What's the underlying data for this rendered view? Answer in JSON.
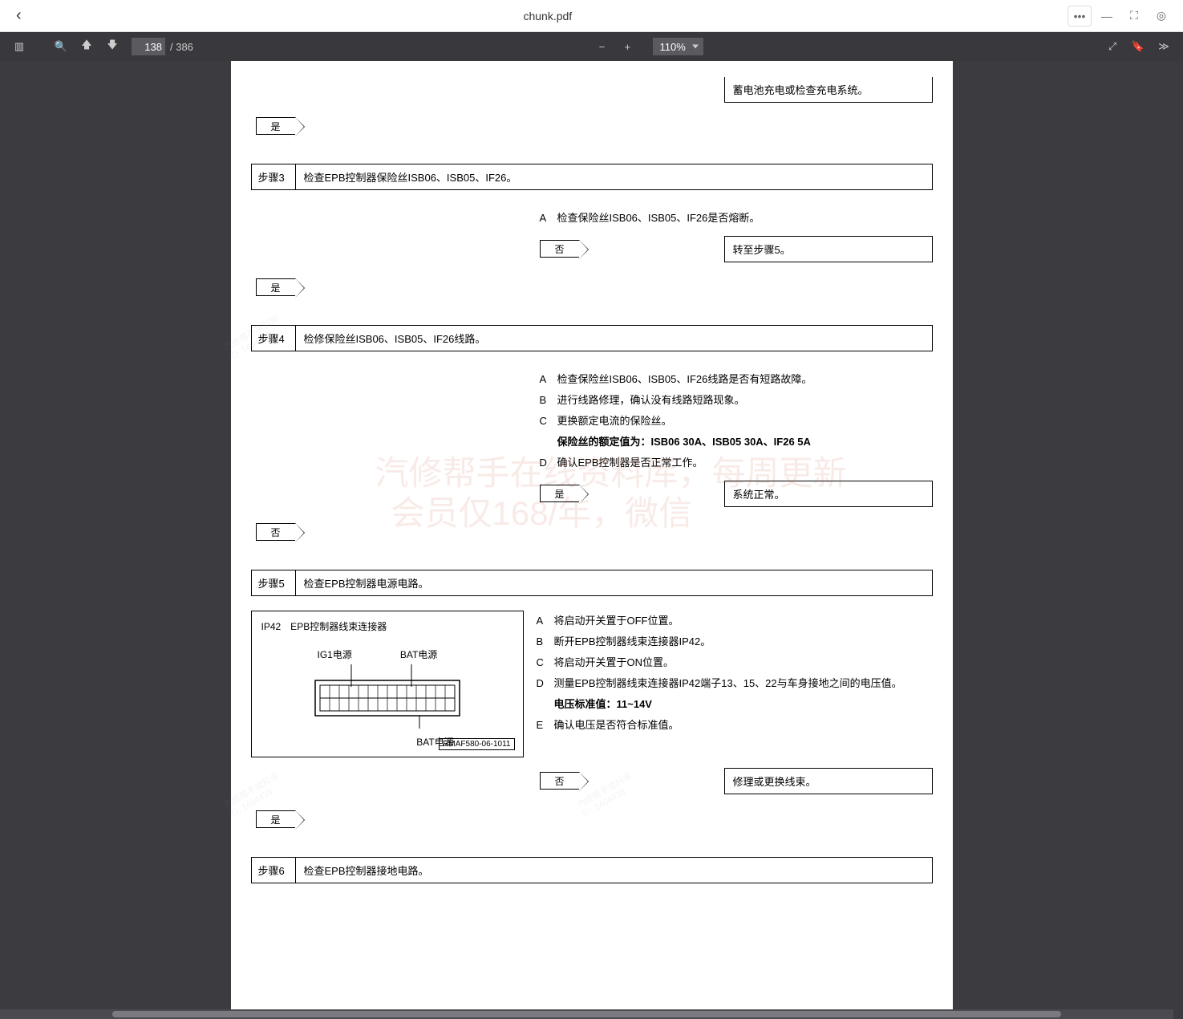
{
  "window": {
    "title": "chunk.pdf"
  },
  "toolbar": {
    "current_page": "138",
    "total_pages": "/ 386",
    "zoom": "110%"
  },
  "doc": {
    "top_action": "蓄电池充电或检查充电系统。",
    "yes": "是",
    "no": "否",
    "step3": {
      "label": "步骤3",
      "content": "检查EPB控制器保险丝ISB06、ISB05、IF26。",
      "A": "检查保险丝ISB06、ISB05、IF26是否熔断。",
      "no_action": "转至步骤5。"
    },
    "step4": {
      "label": "步骤4",
      "content": "检修保险丝ISB06、ISB05、IF26线路。",
      "A": "检查保险丝ISB06、ISB05、IF26线路是否有短路故障。",
      "B": "进行线路修理，确认没有线路短路现象。",
      "C": "更换额定电流的保险丝。",
      "fuse_note": "保险丝的额定值为：ISB06 30A、ISB05 30A、IF26 5A",
      "D": "确认EPB控制器是否正常工作。",
      "yes_action": "系统正常。"
    },
    "step5": {
      "label": "步骤5",
      "content": "检查EPB控制器电源电路。",
      "connector_title": "IP42　EPB控制器线束连接器",
      "ig1": "IG1电源",
      "bat": "BAT电源",
      "bat2": "BAT电源",
      "img_id": "RMAF580-06-1011",
      "A": "将启动开关置于OFF位置。",
      "B": "断开EPB控制器线束连接器IP42。",
      "C": "将启动开关置于ON位置。",
      "D": "测量EPB控制器线束连接器IP42端子13、15、22与车身接地之间的电压值。",
      "voltage": "电压标准值：11~14V",
      "E": "确认电压是否符合标准值。",
      "no_action": "修理或更换线束。"
    },
    "step6": {
      "label": "步骤6",
      "content": "检查EPB控制器接地电路。"
    },
    "watermark1": "汽修帮手在线资料库，每周更新",
    "watermark2": "会员仅168/年，微信"
  }
}
